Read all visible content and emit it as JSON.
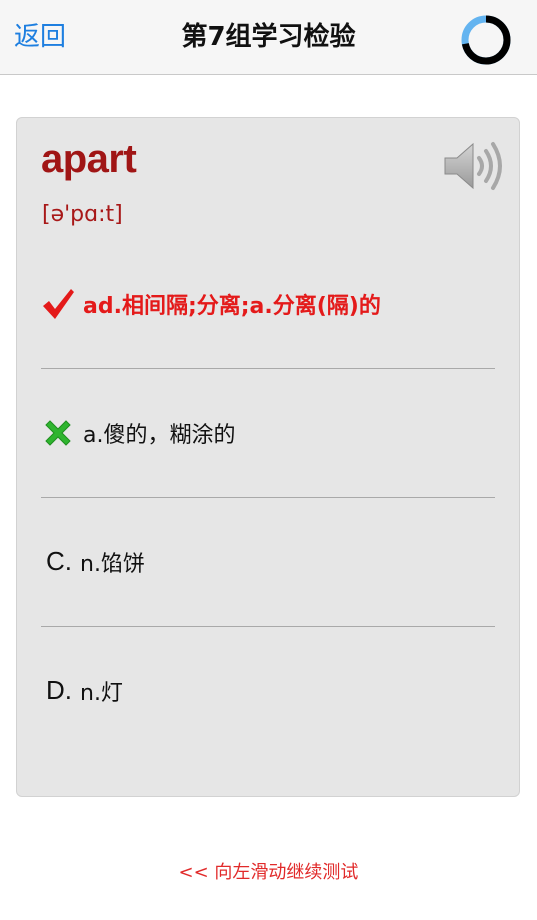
{
  "nav": {
    "back_label": "返回",
    "title": "第7组学习检验",
    "progress": 0.72
  },
  "card": {
    "word": "apart",
    "phonetic": "[ə'pɑ:t]",
    "options": [
      {
        "letter": "",
        "status": "correct",
        "icon": "check-icon",
        "text": "ad.相间隔;分离;a.分离(隔)的"
      },
      {
        "letter": "",
        "status": "wrong",
        "icon": "cross-icon",
        "text": "a.傻的，糊涂的"
      },
      {
        "letter": "C.",
        "status": "neutral",
        "icon": "",
        "text": "n.馅饼"
      },
      {
        "letter": "D.",
        "status": "neutral",
        "icon": "",
        "text": "n.灯"
      }
    ]
  },
  "footer": {
    "hint": "<< 向左滑动继续测试"
  },
  "colors": {
    "accent_blue": "#1e7fe0",
    "word_red": "#a01515",
    "correct_red": "#e41a1a",
    "wrong_green": "#2fb52f",
    "card_bg": "#e6e6e6"
  }
}
